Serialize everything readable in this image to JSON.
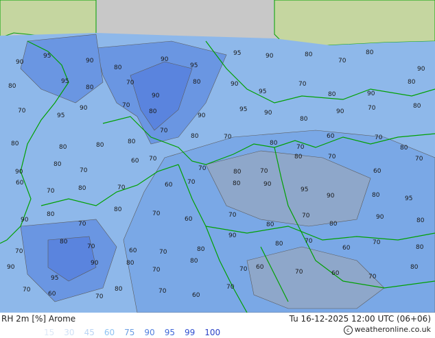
{
  "header": {
    "product": "RH 2m [%] Arome",
    "valid_time": "Tu 16-12-2025 12:00 UTC (06+06)",
    "credit": "© weatheronline.co.uk"
  },
  "legend": {
    "levels": [
      {
        "label": "15",
        "color": "#dce8f6"
      },
      {
        "label": "30",
        "color": "#cfe1f6"
      },
      {
        "label": "45",
        "color": "#b9d4f4"
      },
      {
        "label": "60",
        "color": "#8ec3f3"
      },
      {
        "label": "75",
        "color": "#6a9ee4"
      },
      {
        "label": "90",
        "color": "#5280df"
      },
      {
        "label": "95",
        "color": "#3f68d8"
      },
      {
        "label": "99",
        "color": "#2f4fd0"
      },
      {
        "label": "100",
        "color": "#2940c6"
      }
    ]
  },
  "map": {
    "colors": {
      "outside_domain": "#c8c8c8",
      "land_outside": "#c5d6a0",
      "coast": "#00a000",
      "border": "#00a000",
      "contour": "#5a5a5a",
      "rh_60": "#8eb8ea",
      "rh_75": "#7aa8e6",
      "rh_90": "#6a96e2",
      "rh_95": "#5a84de",
      "rh_dry": "#9fa6b2"
    },
    "contour_labels": [
      {
        "text": "90"
      },
      {
        "text": "95"
      },
      {
        "text": "90"
      },
      {
        "text": "80"
      },
      {
        "text": "90"
      },
      {
        "text": "95"
      },
      {
        "text": "95"
      },
      {
        "text": "90"
      },
      {
        "text": "80"
      },
      {
        "text": "70"
      },
      {
        "text": "80"
      },
      {
        "text": "90"
      },
      {
        "text": "80"
      },
      {
        "text": "95"
      },
      {
        "text": "80"
      },
      {
        "text": "70"
      },
      {
        "text": "90"
      },
      {
        "text": "80"
      },
      {
        "text": "90"
      },
      {
        "text": "95"
      },
      {
        "text": "70"
      },
      {
        "text": "80"
      },
      {
        "text": "90"
      },
      {
        "text": "80"
      },
      {
        "text": "70"
      },
      {
        "text": "95"
      },
      {
        "text": "90"
      },
      {
        "text": "70"
      },
      {
        "text": "80"
      },
      {
        "text": "90"
      },
      {
        "text": "95"
      },
      {
        "text": "90"
      },
      {
        "text": "80"
      },
      {
        "text": "90"
      },
      {
        "text": "70"
      },
      {
        "text": "80"
      },
      {
        "text": "80"
      },
      {
        "text": "80"
      },
      {
        "text": "80"
      },
      {
        "text": "80"
      },
      {
        "text": "70"
      },
      {
        "text": "80"
      },
      {
        "text": "70"
      },
      {
        "text": "80"
      },
      {
        "text": "70"
      },
      {
        "text": "60"
      },
      {
        "text": "70"
      },
      {
        "text": "80"
      },
      {
        "text": "90"
      },
      {
        "text": "80"
      },
      {
        "text": "70"
      },
      {
        "text": "60"
      },
      {
        "text": "70"
      },
      {
        "text": "70"
      },
      {
        "text": "80"
      },
      {
        "text": "70"
      },
      {
        "text": "80"
      },
      {
        "text": "70"
      },
      {
        "text": "60"
      },
      {
        "text": "70"
      },
      {
        "text": "60"
      },
      {
        "text": "70"
      },
      {
        "text": "80"
      },
      {
        "text": "70"
      },
      {
        "text": "60"
      },
      {
        "text": "70"
      },
      {
        "text": "80"
      },
      {
        "text": "90"
      },
      {
        "text": "95"
      },
      {
        "text": "90"
      },
      {
        "text": "80"
      },
      {
        "text": "95"
      },
      {
        "text": "90"
      },
      {
        "text": "80"
      },
      {
        "text": "70"
      },
      {
        "text": "80"
      },
      {
        "text": "70"
      },
      {
        "text": "60"
      },
      {
        "text": "70"
      },
      {
        "text": "80"
      },
      {
        "text": "70"
      },
      {
        "text": "80"
      },
      {
        "text": "90"
      },
      {
        "text": "80"
      },
      {
        "text": "70"
      },
      {
        "text": "80"
      },
      {
        "text": "70"
      },
      {
        "text": "60"
      },
      {
        "text": "70"
      },
      {
        "text": "80"
      },
      {
        "text": "90"
      },
      {
        "text": "80"
      },
      {
        "text": "70"
      },
      {
        "text": "60"
      },
      {
        "text": "70"
      },
      {
        "text": "80"
      },
      {
        "text": "90"
      },
      {
        "text": "95"
      },
      {
        "text": "90"
      },
      {
        "text": "80"
      },
      {
        "text": "70"
      },
      {
        "text": "80"
      },
      {
        "text": "70"
      },
      {
        "text": "60"
      },
      {
        "text": "70"
      },
      {
        "text": "60"
      },
      {
        "text": "70"
      },
      {
        "text": "80"
      },
      {
        "text": "70"
      },
      {
        "text": "60"
      },
      {
        "text": "70"
      },
      {
        "text": "80"
      },
      {
        "text": "70"
      },
      {
        "text": "60"
      },
      {
        "text": "70"
      }
    ]
  }
}
